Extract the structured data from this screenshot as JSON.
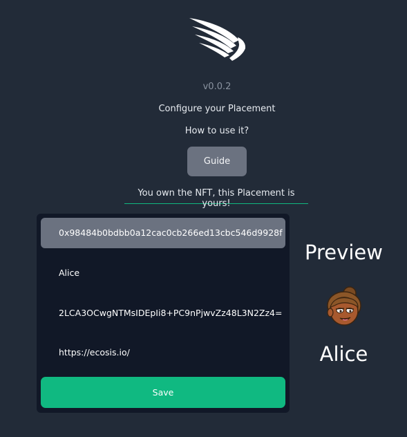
{
  "header": {
    "logo_icon": "wing-logo-icon",
    "version": "v0.0.2",
    "configure_text": "Configure your Placement",
    "howto_text": "How to use it?",
    "guide_label": "Guide",
    "ownership_text": "You own the NFT, this Placement is yours!"
  },
  "form": {
    "address_value": "0x98484b0bdbb0a12cac0cb266ed13cbc546d9928f",
    "name_value": "Alice",
    "image_value": "2LCA3OCwgNTMsIDEpIi8+PC9nPjwvZz48L3N2Zz4=",
    "url_value": "https://ecosis.io/",
    "save_label": "Save"
  },
  "preview": {
    "title": "Preview",
    "avatar_icon": "alice-avatar-icon",
    "name": "Alice"
  },
  "colors": {
    "background": "#222b38",
    "panel": "#111827",
    "accent": "#10b981",
    "button_gray": "#6b7280"
  }
}
